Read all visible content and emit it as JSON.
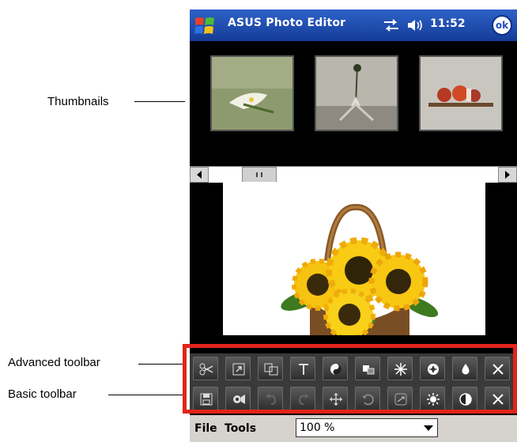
{
  "annotations": {
    "thumbnails": "Thumbnails",
    "advanced_toolbar": "Advanced toolbar",
    "basic_toolbar": "Basic toolbar"
  },
  "titlebar": {
    "title": "ASUS Photo Editor",
    "time": "11:52",
    "ok_label": "ok",
    "icons": [
      "windows-start-icon",
      "connectivity-icon",
      "volume-icon"
    ]
  },
  "thumbnails": [
    "calla-lily-photo",
    "flower-vase-photo",
    "shelf-photo"
  ],
  "canvas": {
    "image": "sunflower-basket-photo"
  },
  "advanced_toolbar": {
    "tools": [
      "scissors-icon",
      "resize-icon",
      "copy-icon",
      "text-icon",
      "color-icon",
      "frame-icon",
      "sparkle-icon",
      "badge-icon",
      "drop-icon",
      "close-icon"
    ]
  },
  "basic_toolbar": {
    "tools": [
      "save-icon",
      "camera-icon",
      "undo-icon",
      "redo-icon",
      "move-icon",
      "rotate-icon",
      "flip-icon",
      "brightness-icon",
      "contrast-icon",
      "close-icon"
    ]
  },
  "menubar": {
    "file": "File",
    "tools": "Tools",
    "zoom_value": "100 %"
  },
  "colors": {
    "titlebar": "#1f4fc0",
    "highlight": "#e2231a",
    "toolbar": "#3a3a3a",
    "menubar": "#d6d3ce"
  }
}
